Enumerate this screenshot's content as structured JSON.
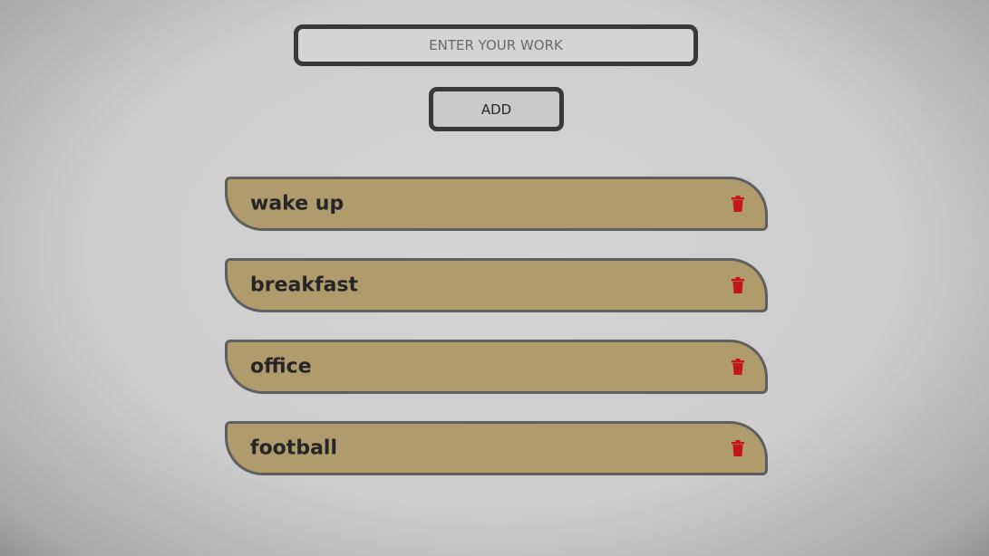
{
  "input": {
    "placeholder": "ENTER YOUR WORK",
    "value": ""
  },
  "add_button": {
    "label": "ADD"
  },
  "tasks": [
    {
      "text": "wake up",
      "delete_icon": "trash-icon"
    },
    {
      "text": "breakfast",
      "delete_icon": "trash-icon"
    },
    {
      "text": "office",
      "delete_icon": "trash-icon"
    },
    {
      "text": "football",
      "delete_icon": "trash-icon"
    }
  ],
  "colors": {
    "task_bg": "#b09b6c",
    "task_border": "#5f5f5f",
    "delete_icon": "#c41818",
    "input_border": "#3a3838",
    "page_bg": "#cdcdcd"
  }
}
